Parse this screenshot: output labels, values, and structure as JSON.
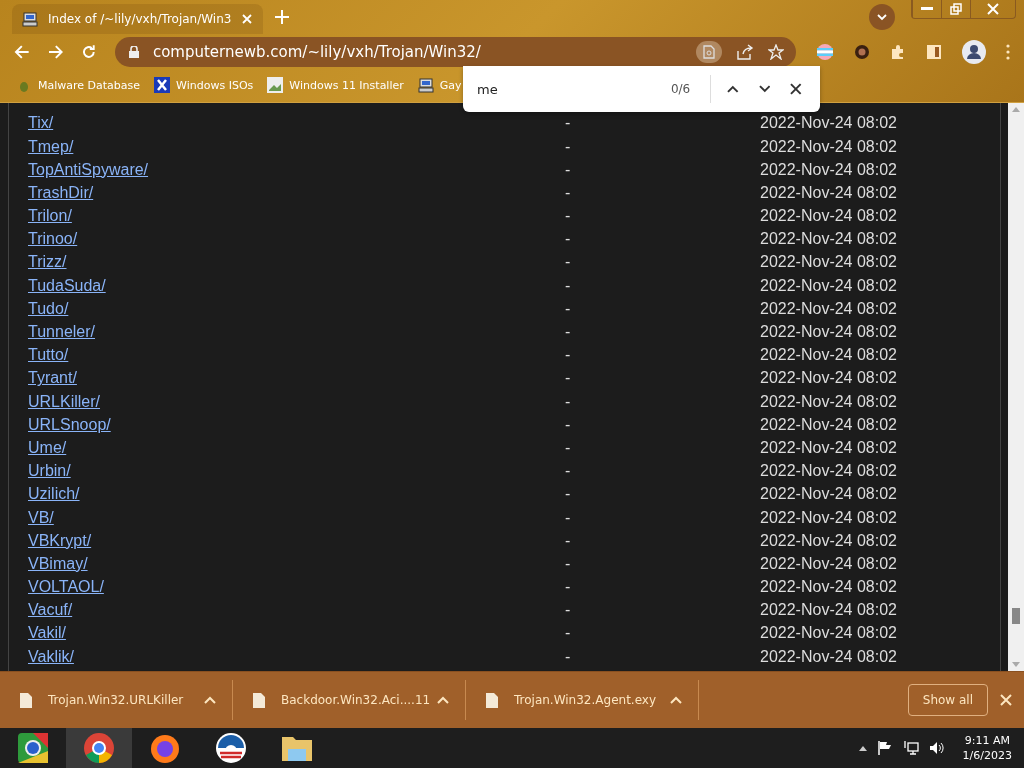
{
  "tab": {
    "title": "Index of /~lily/vxh/Trojan/Win3",
    "selected": true
  },
  "address": {
    "url": "computernewb.com/~lily/vxh/Trojan/Win32/"
  },
  "bookmarks": [
    "Malware Database",
    "Windows ISOs",
    "Windows 11 Installer",
    "Gay"
  ],
  "find_bar": {
    "value": "me",
    "count": "0/6"
  },
  "listing": [
    {
      "name": "Tix/",
      "size": "-",
      "modified": "2022-Nov-24 08:02"
    },
    {
      "name": "Tmep/",
      "size": "-",
      "modified": "2022-Nov-24 08:02"
    },
    {
      "name": "TopAntiSpyware/",
      "size": "-",
      "modified": "2022-Nov-24 08:02"
    },
    {
      "name": "TrashDir/",
      "size": "-",
      "modified": "2022-Nov-24 08:02"
    },
    {
      "name": "Trilon/",
      "size": "-",
      "modified": "2022-Nov-24 08:02"
    },
    {
      "name": "Trinoo/",
      "size": "-",
      "modified": "2022-Nov-24 08:02"
    },
    {
      "name": "Trizz/",
      "size": "-",
      "modified": "2022-Nov-24 08:02"
    },
    {
      "name": "TudaSuda/",
      "size": "-",
      "modified": "2022-Nov-24 08:02"
    },
    {
      "name": "Tudo/",
      "size": "-",
      "modified": "2022-Nov-24 08:02"
    },
    {
      "name": "Tunneler/",
      "size": "-",
      "modified": "2022-Nov-24 08:02"
    },
    {
      "name": "Tutto/",
      "size": "-",
      "modified": "2022-Nov-24 08:02"
    },
    {
      "name": "Tyrant/",
      "size": "-",
      "modified": "2022-Nov-24 08:02"
    },
    {
      "name": "URLKiller/",
      "size": "-",
      "modified": "2022-Nov-24 08:02"
    },
    {
      "name": "URLSnoop/",
      "size": "-",
      "modified": "2022-Nov-24 08:02"
    },
    {
      "name": "Ume/",
      "size": "-",
      "modified": "2022-Nov-24 08:02"
    },
    {
      "name": "Urbin/",
      "size": "-",
      "modified": "2022-Nov-24 08:02"
    },
    {
      "name": "Uzilich/",
      "size": "-",
      "modified": "2022-Nov-24 08:02"
    },
    {
      "name": "VB/",
      "size": "-",
      "modified": "2022-Nov-24 08:02"
    },
    {
      "name": "VBKrypt/",
      "size": "-",
      "modified": "2022-Nov-24 08:02"
    },
    {
      "name": "VBimay/",
      "size": "-",
      "modified": "2022-Nov-24 08:02"
    },
    {
      "name": "VOLTAOL/",
      "size": "-",
      "modified": "2022-Nov-24 08:02"
    },
    {
      "name": "Vacuf/",
      "size": "-",
      "modified": "2022-Nov-24 08:02"
    },
    {
      "name": "Vakil/",
      "size": "-",
      "modified": "2022-Nov-24 08:02"
    },
    {
      "name": "Vaklik/",
      "size": "-",
      "modified": "2022-Nov-24 08:02"
    }
  ],
  "downloads": [
    "Trojan.Win32.URLKiller",
    "Backdoor.Win32.Aci....11",
    "Trojan.Win32.Agent.exy"
  ],
  "show_all": "Show all",
  "clock": {
    "time": "9:11 AM",
    "date": "1/6/2023"
  }
}
